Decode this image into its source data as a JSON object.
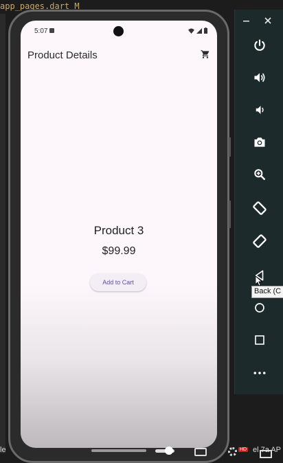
{
  "ide": {
    "tab_label": "app_pages.dart_M"
  },
  "status_bar": {
    "time": "5:07"
  },
  "app_bar": {
    "title": "Product Details",
    "cart_icon": "shopping-cart-icon"
  },
  "product": {
    "name": "Product 3",
    "price": "$99.99",
    "add_to_cart_label": "Add to Cart"
  },
  "emulator_toolbar": {
    "buttons": [
      "minimize-icon",
      "close-icon",
      "power-icon",
      "volume-up-icon",
      "volume-down-icon",
      "camera-icon",
      "zoom-icon",
      "rotate-left-icon",
      "rotate-right-icon",
      "back-icon",
      "home-icon",
      "overview-icon",
      "more-icon"
    ],
    "tooltip": "Back (C"
  },
  "video_bar": {
    "left_text": "le",
    "right_text": "el 7a AP",
    "hd_badge": "HD"
  },
  "colors": {
    "screen_bg": "#fdf7fb",
    "button_text": "#5e4ea0",
    "toolbar_bg": "#1d2a2c"
  }
}
